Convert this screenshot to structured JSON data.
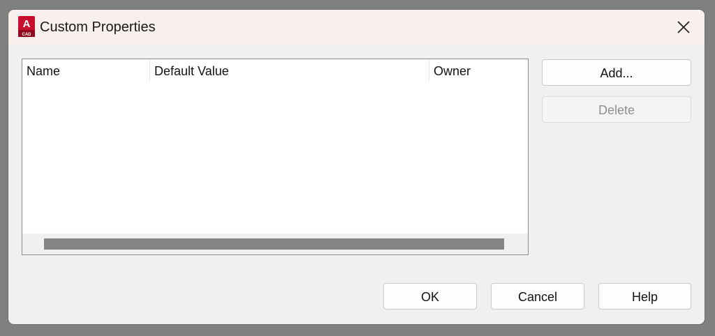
{
  "window": {
    "title": "Custom Properties",
    "app_icon": "autocad-icon",
    "app_icon_badge": "CAD",
    "app_icon_letter": "A",
    "accent_color": "#c8102e"
  },
  "list": {
    "columns": [
      "Name",
      "Default Value",
      "Owner"
    ],
    "rows": []
  },
  "buttons": {
    "add": "Add...",
    "delete": "Delete",
    "ok": "OK",
    "cancel": "Cancel",
    "help": "Help"
  }
}
